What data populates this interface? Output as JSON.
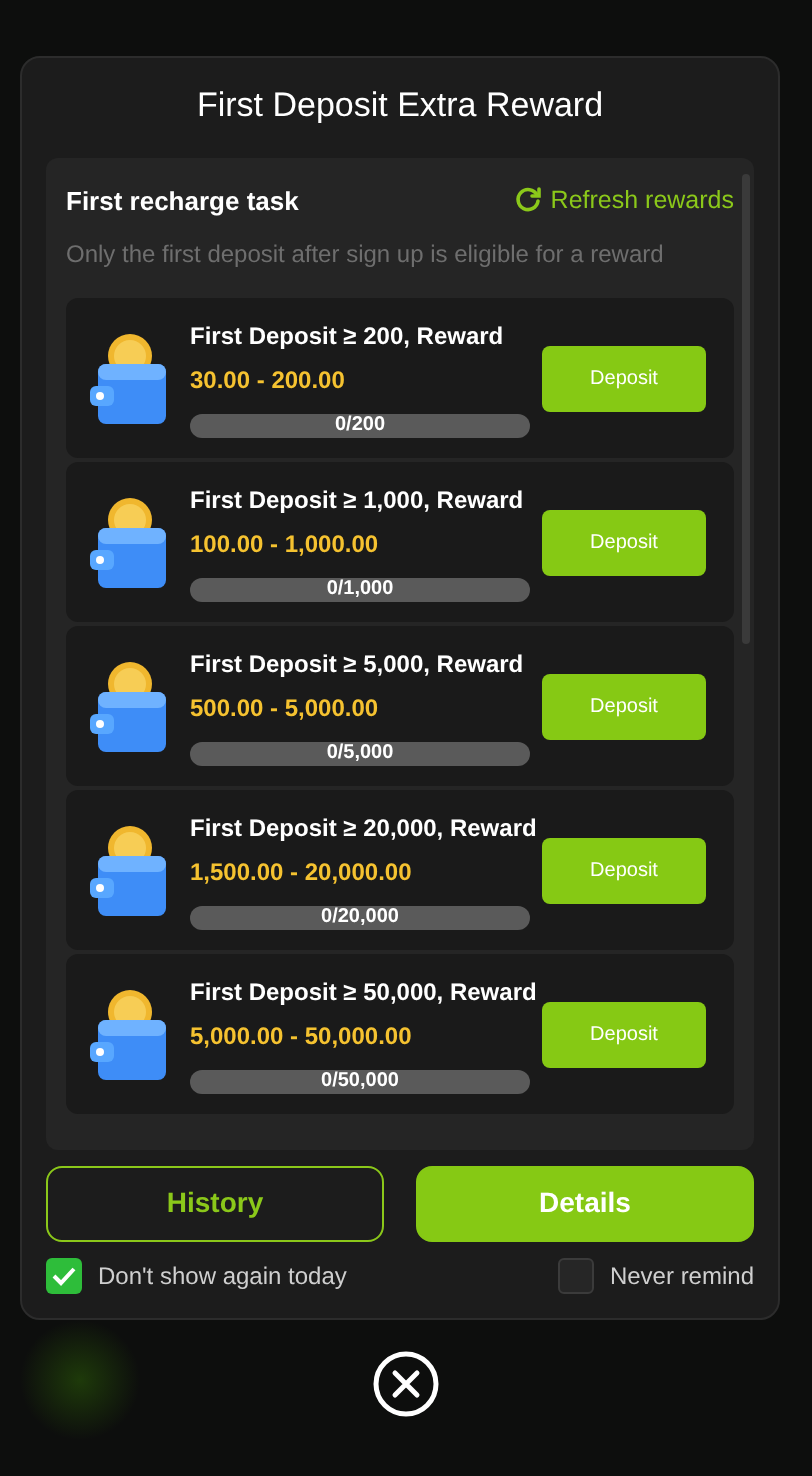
{
  "dialog": {
    "title": "First Deposit Extra Reward"
  },
  "task": {
    "heading": "First recharge task",
    "refresh_label": "Refresh rewards",
    "note": "Only the first deposit after sign up is eligible for a reward"
  },
  "rewards": [
    {
      "condition": "First Deposit ≥ 200, Reward",
      "range": "30.00 - 200.00",
      "progress": "0/200",
      "level": 0,
      "button": "Deposit"
    },
    {
      "condition": "First Deposit ≥ 1,000, Reward",
      "range": "100.00 - 1,000.00",
      "progress": "0/1,000",
      "level": 0,
      "button": "Deposit"
    },
    {
      "condition": "First Deposit ≥ 5,000, Reward",
      "range": "500.00 - 5,000.00",
      "progress": "0/5,000",
      "level": 0,
      "button": "Deposit"
    },
    {
      "condition": "First Deposit ≥ 20,000, Reward",
      "range": "1,500.00 - 20,000.00",
      "progress": "0/20,000",
      "level": 0,
      "button": "Deposit"
    },
    {
      "condition": "First Deposit ≥ 50,000, Reward",
      "range": "5,000.00 - 50,000.00",
      "progress": "0/50,000",
      "level": 0,
      "button": "Deposit"
    }
  ],
  "buttons": [
    {
      "label": "History",
      "kind": "outline"
    },
    {
      "label": "Details",
      "kind": "solid"
    }
  ],
  "options": [
    {
      "label": "Don't show again today",
      "checked": true
    },
    {
      "label": "Never remind",
      "checked": false
    }
  ]
}
